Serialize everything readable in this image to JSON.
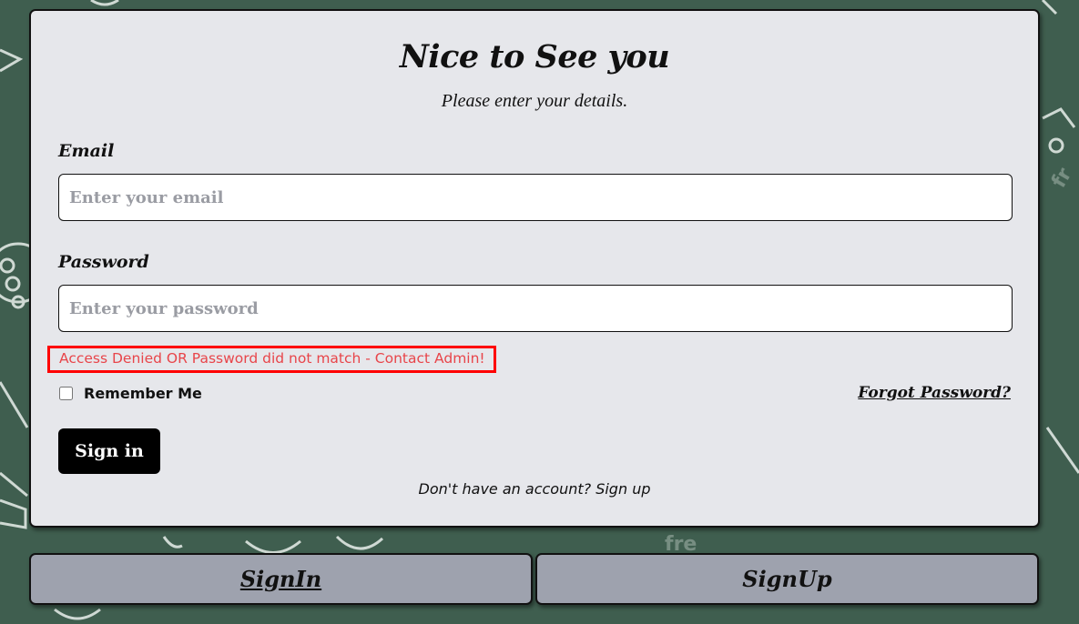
{
  "form": {
    "title": "Nice to See you",
    "subtitle": "Please enter your details.",
    "email_label": "Email",
    "email_placeholder": "Enter your email",
    "email_value": "",
    "password_label": "Password",
    "password_placeholder": "Enter your password",
    "password_value": "",
    "error_message": "Access Denied OR Password did not match - Contact Admin!",
    "remember_label": "Remember Me",
    "remember_checked": false,
    "forgot_label": "Forgot Password?",
    "signin_button": "Sign in",
    "signup_prompt": "Don't have an account? Sign up"
  },
  "tabs": [
    {
      "label": "SignIn",
      "active": true
    },
    {
      "label": "SignUp",
      "active": false
    }
  ],
  "colors": {
    "background": "#3f5e4f",
    "card": "#e6e7eb",
    "error": "#e8454a",
    "error_border": "#ff0000",
    "tab": "#9ea2ae"
  }
}
